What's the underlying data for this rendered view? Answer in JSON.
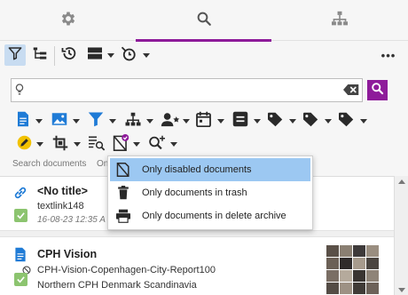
{
  "tabs": [
    {
      "icon": "gear-icon"
    },
    {
      "icon": "search-icon",
      "active": true
    },
    {
      "icon": "hierarchy-icon"
    }
  ],
  "toolbar": {
    "more": "•••"
  },
  "search": {
    "value": "",
    "placeholder": ""
  },
  "hint": {
    "text": "Search documents",
    "text2": "On"
  },
  "menu": {
    "items": [
      {
        "label": "Only disabled documents",
        "icon": "disabled-document-icon",
        "highlighted": true
      },
      {
        "label": "Only documents in trash",
        "icon": "trash-icon"
      },
      {
        "label": "Only documents in delete archive",
        "icon": "archive-icon"
      }
    ]
  },
  "results": [
    {
      "title": "<No title>",
      "line1": "textlink148",
      "date": "16-08-23 12:35 A",
      "icon": "link-icon"
    },
    {
      "title": "CPH Vision",
      "line1": "CPH-Vision-Copenhagen-City-Report100",
      "line2": "Northern CPH Denmark Scandinavia",
      "icon": "document-icon"
    }
  ],
  "colors": {
    "accent": "#8e1b9a",
    "blue": "#1f7bd6",
    "highlight": "#9cc8f2",
    "check": "#8cc46f"
  }
}
